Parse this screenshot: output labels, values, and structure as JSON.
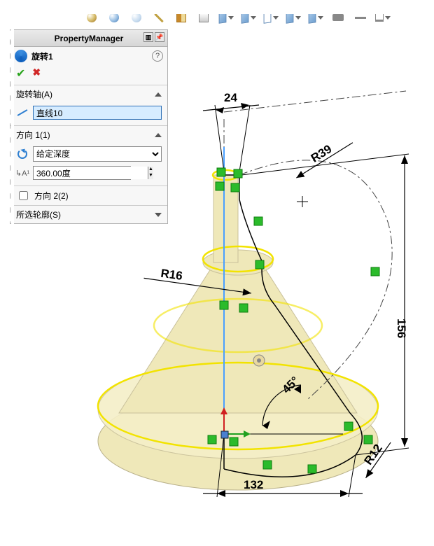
{
  "toolbar": {
    "icons": [
      "plane-icon",
      "zoom-icon",
      "magnify-icon",
      "measure-icon",
      "section-icon",
      "appearance-icon",
      "view-style-icon",
      "shaded-icon",
      "hidden-icon",
      "perspective-icon",
      "shadow-icon",
      "camera-icon",
      "grid-icon",
      "monitor-icon"
    ]
  },
  "panel": {
    "title": "PropertyManager",
    "feature_name": "旋转1",
    "sections": {
      "axis": {
        "label": "旋转轴(A)",
        "value": "直线10"
      },
      "direction1": {
        "label": "方向 1(1)",
        "end_condition": "给定深度",
        "angle_value": "360.00度"
      },
      "direction2": {
        "checkbox_label": "方向 2(2)",
        "checked": false
      },
      "contours": {
        "label": "所选轮廓(S)"
      }
    }
  },
  "dimensions": {
    "d_top": "24",
    "d_r39": "R39",
    "d_156": "156",
    "d_r16": "R16",
    "d_45": "45°",
    "d_r12": "R12",
    "d_132": "132"
  },
  "chart_data": {
    "type": "sketch-revolve",
    "axis": "vertical centerline",
    "profile_dimensions": {
      "top_width": 24,
      "top_fillet_radius": 39,
      "total_height": 156,
      "neck_fillet_radius": 16,
      "cone_angle_deg": 45,
      "bottom_fillet_radius": 12,
      "base_width": 132
    },
    "revolve_angle_deg": 360
  }
}
